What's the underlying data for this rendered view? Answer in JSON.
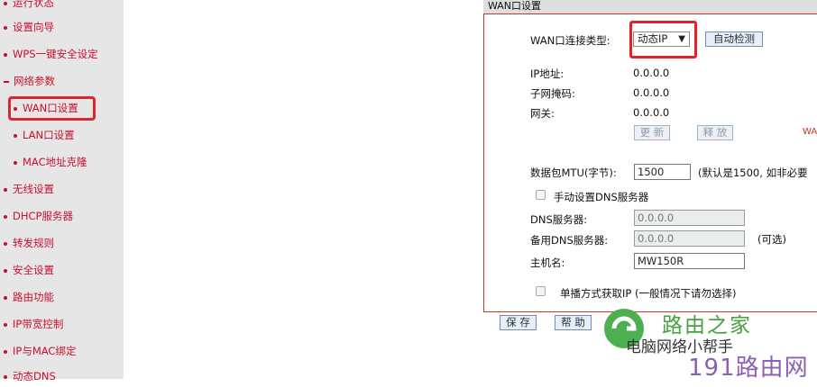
{
  "sidebar": {
    "items": [
      {
        "label": "运行状态"
      },
      {
        "label": "设置向导"
      },
      {
        "label": "WPS一键安全设定"
      },
      {
        "label": "网络参数"
      },
      {
        "label": "WAN口设置"
      },
      {
        "label": "LAN口设置"
      },
      {
        "label": "MAC地址克隆"
      },
      {
        "label": "无线设置"
      },
      {
        "label": "DHCP服务器"
      },
      {
        "label": "转发规则"
      },
      {
        "label": "安全设置"
      },
      {
        "label": "路由功能"
      },
      {
        "label": "IP带宽控制"
      },
      {
        "label": "IP与MAC绑定"
      },
      {
        "label": "动态DNS"
      }
    ]
  },
  "panel": {
    "title": "WAN口设置",
    "conn_type_label": "WAN口连接类型:",
    "conn_type_value": "动态IP",
    "auto_detect": "自动检测",
    "ip_label": "IP地址:",
    "ip_value": "0.0.0.0",
    "mask_label": "子网掩码:",
    "mask_value": "0.0.0.0",
    "gateway_label": "网关:",
    "gateway_value": "0.0.0.0",
    "renew": "更 新",
    "release": "释 放",
    "wan_cut": "WAI",
    "mtu_label": "数据包MTU(字节):",
    "mtu_value": "1500",
    "mtu_hint": "(默认是1500, 如非必要",
    "manual_dns_label": "手动设置DNS服务器",
    "dns_label": "DNS服务器:",
    "dns_value": "0.0.0.0",
    "dns2_label": "备用DNS服务器:",
    "dns2_value": "0.0.0.0",
    "optional": "(可选)",
    "host_label": "主机名:",
    "host_value": "MW150R",
    "unicast_label": "单播方式获取IP (一般情况下请勿选择)",
    "save": "保 存",
    "help": "帮 助"
  },
  "watermark": {
    "site": "路由之家",
    "wechat": "电脑网络小帮手",
    "brand": "191路由网"
  }
}
